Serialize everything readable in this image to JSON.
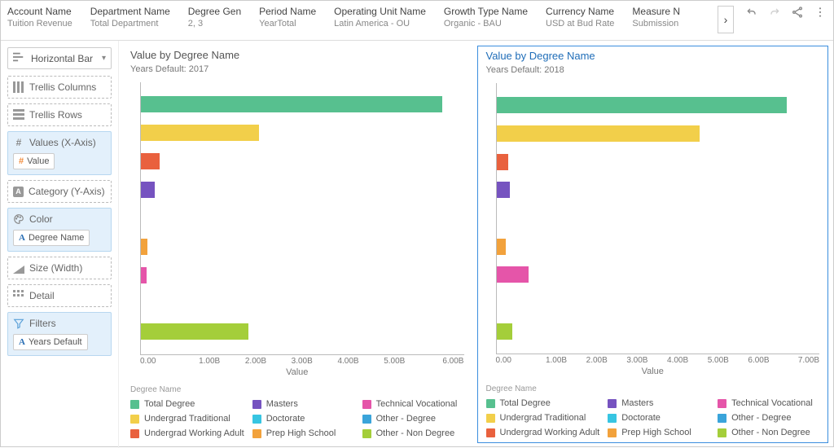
{
  "header": {
    "filters": [
      {
        "label": "Account Name",
        "value": "Tuition Revenue"
      },
      {
        "label": "Department Name",
        "value": "Total Department"
      },
      {
        "label": "Degree Gen",
        "value": "2, 3"
      },
      {
        "label": "Period Name",
        "value": "YearTotal"
      },
      {
        "label": "Operating Unit Name",
        "value": "Latin America - OU"
      },
      {
        "label": "Growth Type Name",
        "value": "Organic - BAU"
      },
      {
        "label": "Currency Name",
        "value": "USD at Bud Rate"
      },
      {
        "label": "Measure N",
        "value": "Submission"
      }
    ]
  },
  "sidebar": {
    "chartType": "Horizontal Bar",
    "wells": {
      "trellisColumns": "Trellis Columns",
      "trellisRows": "Trellis Rows",
      "valuesX": "Values (X-Axis)",
      "valuesXPill": "Value",
      "categoryY": "Category (Y-Axis)",
      "color": "Color",
      "colorPill": "Degree Name",
      "size": "Size (Width)",
      "detail": "Detail",
      "filters": "Filters",
      "filtersPill": "Years Default"
    }
  },
  "panels": [
    {
      "title": "Value by Degree Name",
      "subLabel": "Years Default:",
      "subValue": "2017",
      "axisLabel": "Value",
      "xmax": 6,
      "ticks": [
        "0.00",
        "1.00B",
        "2.00B",
        "3.00B",
        "4.00B",
        "5.00B",
        "6.00B"
      ]
    },
    {
      "title": "Value by Degree Name",
      "subLabel": "Years Default:",
      "subValue": "2018",
      "axisLabel": "Value",
      "xmax": 7,
      "ticks": [
        "0.00",
        "1.00B",
        "2.00B",
        "3.00B",
        "4.00B",
        "5.00B",
        "6.00B",
        "7.00B"
      ]
    }
  ],
  "legend": {
    "title": "Degree Name",
    "items": [
      {
        "name": "Total Degree",
        "color": "#57c08f"
      },
      {
        "name": "Masters",
        "color": "#7653c0"
      },
      {
        "name": "Technical Vocational",
        "color": "#e555a9"
      },
      {
        "name": "Undergrad Traditional",
        "color": "#f2cf4a"
      },
      {
        "name": "Doctorate",
        "color": "#37c5e2"
      },
      {
        "name": "Other - Degree",
        "color": "#3aa4da"
      },
      {
        "name": "Undergrad Working Adult",
        "color": "#e9613e"
      },
      {
        "name": "Prep High School",
        "color": "#f2a23c"
      },
      {
        "name": "Other - Non Degree",
        "color": "#a4ce3a"
      }
    ]
  },
  "chart_data": [
    {
      "type": "bar",
      "orientation": "horizontal",
      "title": "Value by Degree Name",
      "sublabel": "Years Default: 2017",
      "xlabel": "Value",
      "ylabel": "",
      "xlim": [
        0,
        6
      ],
      "x_ticks": [
        0,
        1,
        2,
        3,
        4,
        5,
        6
      ],
      "x_unit": "B",
      "categories": [
        "Total Degree",
        "Undergrad Traditional",
        "Undergrad Working Adult",
        "Masters",
        "Doctorate",
        "Prep High School",
        "Technical Vocational",
        "Other - Degree",
        "Other - Non Degree"
      ],
      "values": [
        5.6,
        2.2,
        0.35,
        0.25,
        0.0,
        0.12,
        0.1,
        0.0,
        2.0
      ],
      "colors": [
        "#57c08f",
        "#f2cf4a",
        "#e9613e",
        "#7653c0",
        "#37c5e2",
        "#f2a23c",
        "#e555a9",
        "#3aa4da",
        "#a4ce3a"
      ]
    },
    {
      "type": "bar",
      "orientation": "horizontal",
      "title": "Value by Degree Name",
      "sublabel": "Years Default: 2018",
      "xlabel": "Value",
      "ylabel": "",
      "xlim": [
        0,
        7
      ],
      "x_ticks": [
        0,
        1,
        2,
        3,
        4,
        5,
        6,
        7
      ],
      "x_unit": "B",
      "categories": [
        "Total Degree",
        "Undergrad Traditional",
        "Undergrad Working Adult",
        "Masters",
        "Doctorate",
        "Prep High School",
        "Technical Vocational",
        "Other - Degree",
        "Other - Non Degree"
      ],
      "values": [
        6.3,
        4.4,
        0.25,
        0.3,
        0.0,
        0.2,
        0.7,
        0.0,
        0.35
      ],
      "colors": [
        "#57c08f",
        "#f2cf4a",
        "#e9613e",
        "#7653c0",
        "#37c5e2",
        "#f2a23c",
        "#e555a9",
        "#3aa4da",
        "#a4ce3a"
      ]
    }
  ]
}
